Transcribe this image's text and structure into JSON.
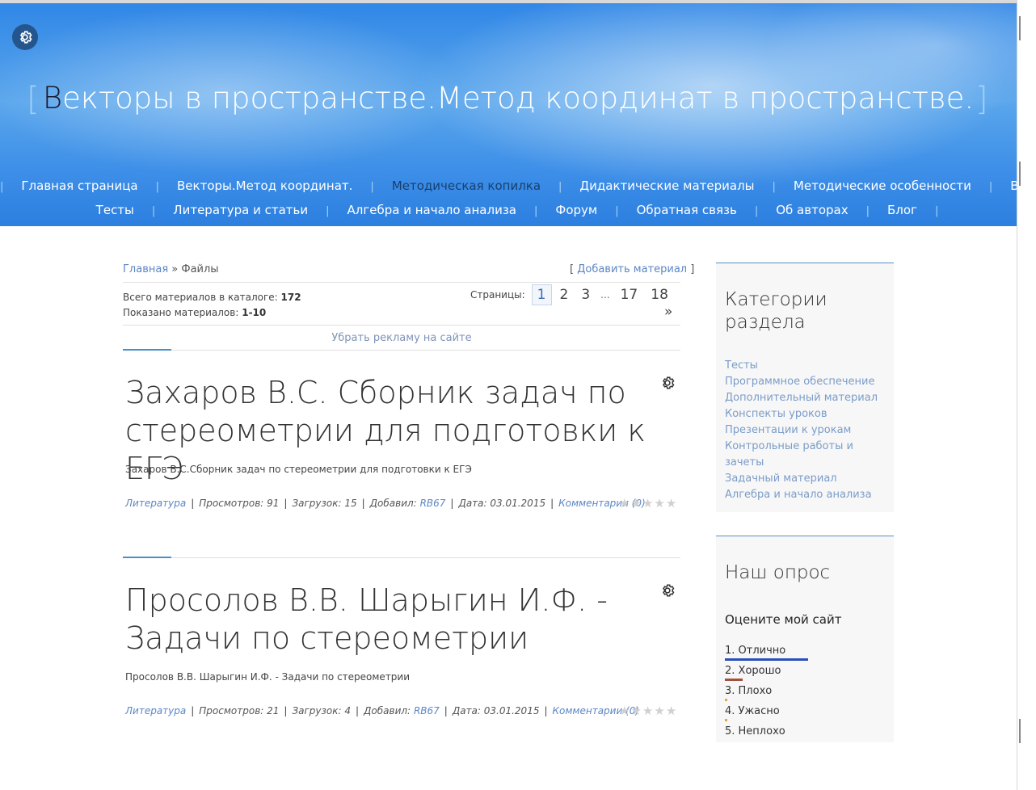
{
  "header": {
    "title_first_letter": "В",
    "title_rest": "екторы в пространстве.Метод координат в пространстве.",
    "bracket_left": "[",
    "bracket_right": "]",
    "menu_row1": [
      "Главная страница",
      "Векторы.Метод координат.",
      "Методическая копилка",
      "Дидактические материалы",
      "Методические особенности",
      "Видеоуроки"
    ],
    "menu_row2": [
      "Тесты",
      "Литература и статьи",
      "Алгебра и начало анализа",
      "Форум",
      "Обратная связь",
      "Об авторах",
      "Блог"
    ],
    "menu_separator": "|"
  },
  "breadcrumb": {
    "home": "Главная",
    "sep": " » ",
    "current": "Файлы"
  },
  "add_material": "Добавить материал",
  "stats": {
    "total_label": "Всего материалов в каталоге:",
    "total_value": "172",
    "shown_label": "Показано материалов:",
    "shown_value": "1-10"
  },
  "pager": {
    "label": "Страницы:",
    "pages": [
      "1",
      "2",
      "3",
      "17",
      "18"
    ],
    "dots": "...",
    "next": "»"
  },
  "ad_link": "Убрать рекламу на сайте",
  "entries": [
    {
      "title": "Захаров В.С. Сборник задач по стереометрии для подготовки к ЕГЭ",
      "desc": "Захаров В.С.Сборник задач по стереометрии для подготовки к ЕГЭ",
      "category": "Литература",
      "views": "Просмотров: 91",
      "downloads": "Загрузок: 15",
      "added_label": "Добавил:",
      "author": "RB67",
      "date": "Дата: 03.01.2015",
      "comments": "Комментарии (0)"
    },
    {
      "title": "Просолов В.В. Шарыгин И.Ф. - Задачи по стереометрии",
      "desc": "Просолов В.В. Шарыгин И.Ф. - Задачи по стереометрии",
      "category": "Литература",
      "views": "Просмотров: 21",
      "downloads": "Загрузок: 4",
      "added_label": "Добавил:",
      "author": "RB67",
      "date": "Дата: 03.01.2015",
      "comments": "Комментарии (0)"
    }
  ],
  "sidebar": {
    "categories_title": "Категории раздела",
    "categories": [
      "Тесты",
      "Программное обеспечение",
      "Дополнительный материал",
      "Конспекты уроков",
      "Презентации к урокам",
      "Контрольные работы и зачеты",
      "Задачный материал",
      "Алгебра и начало анализа"
    ],
    "poll_title": "Наш опрос",
    "poll_question": "Оцените мой сайт",
    "poll_options": [
      {
        "label": "1. Отлично",
        "share": 0.47,
        "color": "#2b4fb8"
      },
      {
        "label": "2. Хорошо",
        "share": 0.1,
        "color": "#a0523d"
      },
      {
        "label": "3. Плохо",
        "share": 0.01,
        "color": "#e8a33a"
      },
      {
        "label": "4. Ужасно",
        "share": 0.01,
        "color": "#e8a33a"
      },
      {
        "label": "5. Неплохо",
        "share": 0,
        "color": "#cccccc"
      }
    ]
  }
}
